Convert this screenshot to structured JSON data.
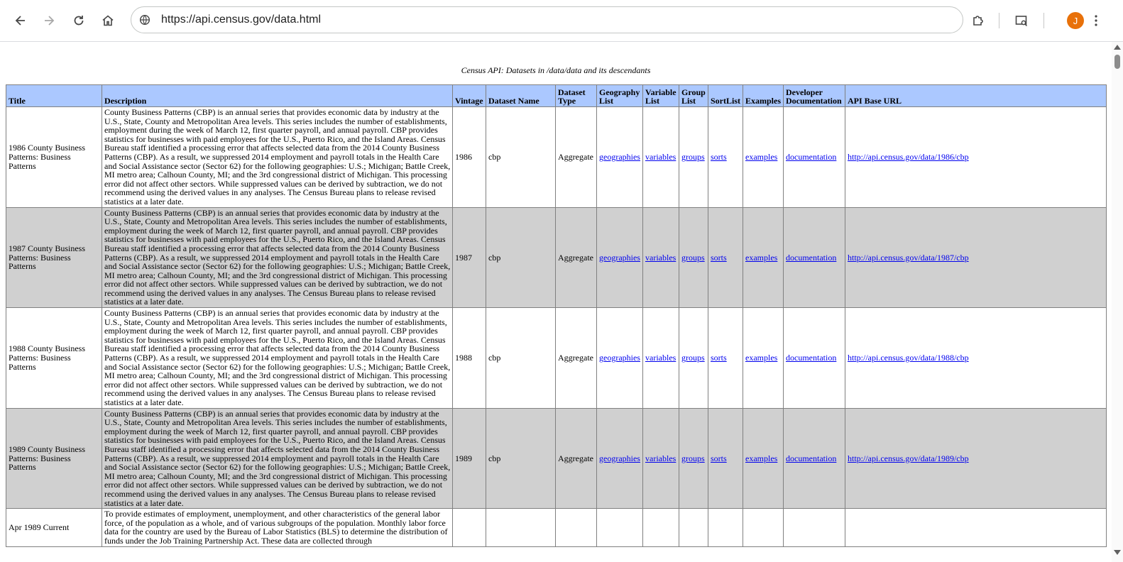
{
  "browser": {
    "url": "https://api.census.gov/data.html",
    "profile_initial": "J",
    "avatar_color": "#e8710a"
  },
  "page": {
    "caption": "Census API: Datasets in /data/data and its descendants",
    "header_color": "#abc8ff",
    "alt_row_color": "#d0d0d0",
    "link_color": "#0000ee",
    "columns": [
      "Title",
      "Description",
      "Vintage",
      "Dataset Name",
      "Dataset Type",
      "Geography List",
      "Variable List",
      "Group List",
      "SortList",
      "Examples",
      "Developer Documentation",
      "API Base URL"
    ],
    "rows": [
      {
        "title": "1986 County Business Patterns: Business Patterns",
        "description": "County Business Patterns (CBP) is an annual series that provides economic data by industry at the U.S., State, County and Metropolitan Area levels. This series includes the number of establishments, employment during the week of March 12, first quarter payroll, and annual payroll. CBP provides statistics for businesses with paid employees for the U.S., Puerto Rico, and the Island Areas. Census Bureau staff identified a processing error that affects selected data from the 2014 County Business Patterns (CBP). As a result, we suppressed 2014 employment and payroll totals in the Health Care and Social Assistance sector (Sector 62) for the following geographies: U.S.; Michigan; Battle Creek, MI metro area; Calhoun County, MI; and the 3rd congressional district of Michigan. This processing error did not affect other sectors. While suppressed values can be derived by subtraction, we do not recommend using the derived values in any analyses. The Census Bureau plans to release revised statistics at a later date.",
        "vintage": "1986",
        "dataset_name": "cbp",
        "dataset_type": "Aggregate",
        "geography": "geographies",
        "variables": "variables",
        "groups": "groups",
        "sorts": "sorts",
        "examples": "examples",
        "documentation": "documentation",
        "base_url": "http://api.census.gov/data/1986/cbp"
      },
      {
        "title": "1987 County Business Patterns: Business Patterns",
        "description": "County Business Patterns (CBP) is an annual series that provides economic data by industry at the U.S., State, County and Metropolitan Area levels. This series includes the number of establishments, employment during the week of March 12, first quarter payroll, and annual payroll. CBP provides statistics for businesses with paid employees for the U.S., Puerto Rico, and the Island Areas. Census Bureau staff identified a processing error that affects selected data from the 2014 County Business Patterns (CBP). As a result, we suppressed 2014 employment and payroll totals in the Health Care and Social Assistance sector (Sector 62) for the following geographies: U.S.; Michigan; Battle Creek, MI metro area; Calhoun County, MI; and the 3rd congressional district of Michigan. This processing error did not affect other sectors. While suppressed values can be derived by subtraction, we do not recommend using the derived values in any analyses. The Census Bureau plans to release revised statistics at a later date.",
        "vintage": "1987",
        "dataset_name": "cbp",
        "dataset_type": "Aggregate",
        "geography": "geographies",
        "variables": "variables",
        "groups": "groups",
        "sorts": "sorts",
        "examples": "examples",
        "documentation": "documentation",
        "base_url": "http://api.census.gov/data/1987/cbp"
      },
      {
        "title": "1988 County Business Patterns: Business Patterns",
        "description": "County Business Patterns (CBP) is an annual series that provides economic data by industry at the U.S., State, County and Metropolitan Area levels. This series includes the number of establishments, employment during the week of March 12, first quarter payroll, and annual payroll. CBP provides statistics for businesses with paid employees for the U.S., Puerto Rico, and the Island Areas. Census Bureau staff identified a processing error that affects selected data from the 2014 County Business Patterns (CBP). As a result, we suppressed 2014 employment and payroll totals in the Health Care and Social Assistance sector (Sector 62) for the following geographies: U.S.; Michigan; Battle Creek, MI metro area; Calhoun County, MI; and the 3rd congressional district of Michigan. This processing error did not affect other sectors. While suppressed values can be derived by subtraction, we do not recommend using the derived values in any analyses. The Census Bureau plans to release revised statistics at a later date.",
        "vintage": "1988",
        "dataset_name": "cbp",
        "dataset_type": "Aggregate",
        "geography": "geographies",
        "variables": "variables",
        "groups": "groups",
        "sorts": "sorts",
        "examples": "examples",
        "documentation": "documentation",
        "base_url": "http://api.census.gov/data/1988/cbp"
      },
      {
        "title": "1989 County Business Patterns: Business Patterns",
        "description": "County Business Patterns (CBP) is an annual series that provides economic data by industry at the U.S., State, County and Metropolitan Area levels. This series includes the number of establishments, employment during the week of March 12, first quarter payroll, and annual payroll. CBP provides statistics for businesses with paid employees for the U.S., Puerto Rico, and the Island Areas. Census Bureau staff identified a processing error that affects selected data from the 2014 County Business Patterns (CBP). As a result, we suppressed 2014 employment and payroll totals in the Health Care and Social Assistance sector (Sector 62) for the following geographies: U.S.; Michigan; Battle Creek, MI metro area; Calhoun County, MI; and the 3rd congressional district of Michigan. This processing error did not affect other sectors. While suppressed values can be derived by subtraction, we do not recommend using the derived values in any analyses. The Census Bureau plans to release revised statistics at a later date.",
        "vintage": "1989",
        "dataset_name": "cbp",
        "dataset_type": "Aggregate",
        "geography": "geographies",
        "variables": "variables",
        "groups": "groups",
        "sorts": "sorts",
        "examples": "examples",
        "documentation": "documentation",
        "base_url": "http://api.census.gov/data/1989/cbp"
      },
      {
        "title": "Apr 1989 Current",
        "description": "To provide estimates of employment, unemployment, and other characteristics of the general labor force, of the population as a whole, and of various subgroups of the population. Monthly labor force data for the country are used by the Bureau of Labor Statistics (BLS) to determine the distribution of funds under the Job Training Partnership Act. These data are collected through",
        "vintage": "",
        "dataset_name": "",
        "dataset_type": "",
        "geography": "",
        "variables": "",
        "groups": "",
        "sorts": "",
        "examples": "",
        "documentation": "",
        "base_url": ""
      }
    ]
  }
}
